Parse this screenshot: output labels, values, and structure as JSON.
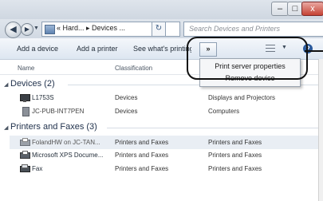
{
  "window": {
    "minimize_glyph": "–",
    "maximize_glyph": "□",
    "close_glyph": "x"
  },
  "address": {
    "path": "« Hard... ▸ Devices ...",
    "search_placeholder": "Search Devices and Printers"
  },
  "toolbar": {
    "add_device": "Add a device",
    "add_printer": "Add a printer",
    "see_whats": "See what's printing",
    "chevron": "»"
  },
  "columns": {
    "name": "Name",
    "classification": "Classification"
  },
  "menu": {
    "items": [
      "Print server properties",
      "Remove device"
    ]
  },
  "groups": [
    {
      "label": "Devices (2)",
      "items": [
        {
          "name": "L1753S",
          "classification": "Devices",
          "category": "Displays and Projectors",
          "icon": "monitor-icon"
        },
        {
          "name": "JC-PUB-INT7PEN",
          "classification": "Devices",
          "category": "Computers",
          "icon": "computer-icon"
        }
      ]
    },
    {
      "label": "Printers and Faxes (3)",
      "items": [
        {
          "name": "FolandHW on JC-TAN...",
          "classification": "Printers and Faxes",
          "category": "Printers and Faxes",
          "icon": "printer-icon"
        },
        {
          "name": "Microsoft XPS Docume...",
          "classification": "Printers and Faxes",
          "category": "Printers and Faxes",
          "icon": "printer-icon"
        },
        {
          "name": "Fax",
          "classification": "Printers and Faxes",
          "category": "Printers and Faxes",
          "icon": "fax-icon"
        }
      ]
    }
  ]
}
